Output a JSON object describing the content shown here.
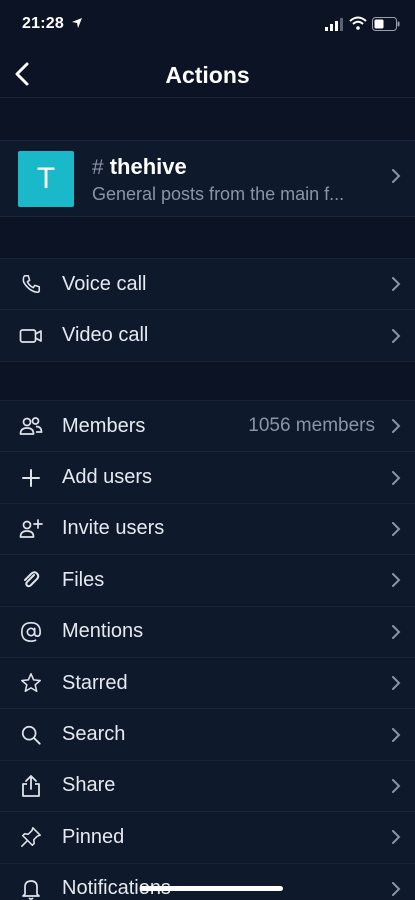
{
  "status_bar": {
    "time": "21:28"
  },
  "header": {
    "title": "Actions"
  },
  "channel": {
    "avatar_letter": "T",
    "hash": "#",
    "name": "thehive",
    "description": "General posts from the main f..."
  },
  "calls": [
    {
      "label": "Voice call",
      "icon": "phone-icon"
    },
    {
      "label": "Video call",
      "icon": "video-icon"
    }
  ],
  "actions": [
    {
      "label": "Members",
      "value": "1056 members",
      "icon": "members-icon"
    },
    {
      "label": "Add users",
      "icon": "plus-icon"
    },
    {
      "label": "Invite users",
      "icon": "invite-user-icon"
    },
    {
      "label": "Files",
      "icon": "paperclip-icon"
    },
    {
      "label": "Mentions",
      "icon": "at-icon"
    },
    {
      "label": "Starred",
      "icon": "star-icon"
    },
    {
      "label": "Search",
      "icon": "search-icon"
    },
    {
      "label": "Share",
      "icon": "share-icon"
    },
    {
      "label": "Pinned",
      "icon": "pin-icon"
    },
    {
      "label": "Notifications",
      "icon": "bell-icon"
    }
  ],
  "colors": {
    "background": "#0b1324",
    "row": "#0f192c",
    "accent": "#1ab9c9",
    "muted": "#8b94a6"
  }
}
